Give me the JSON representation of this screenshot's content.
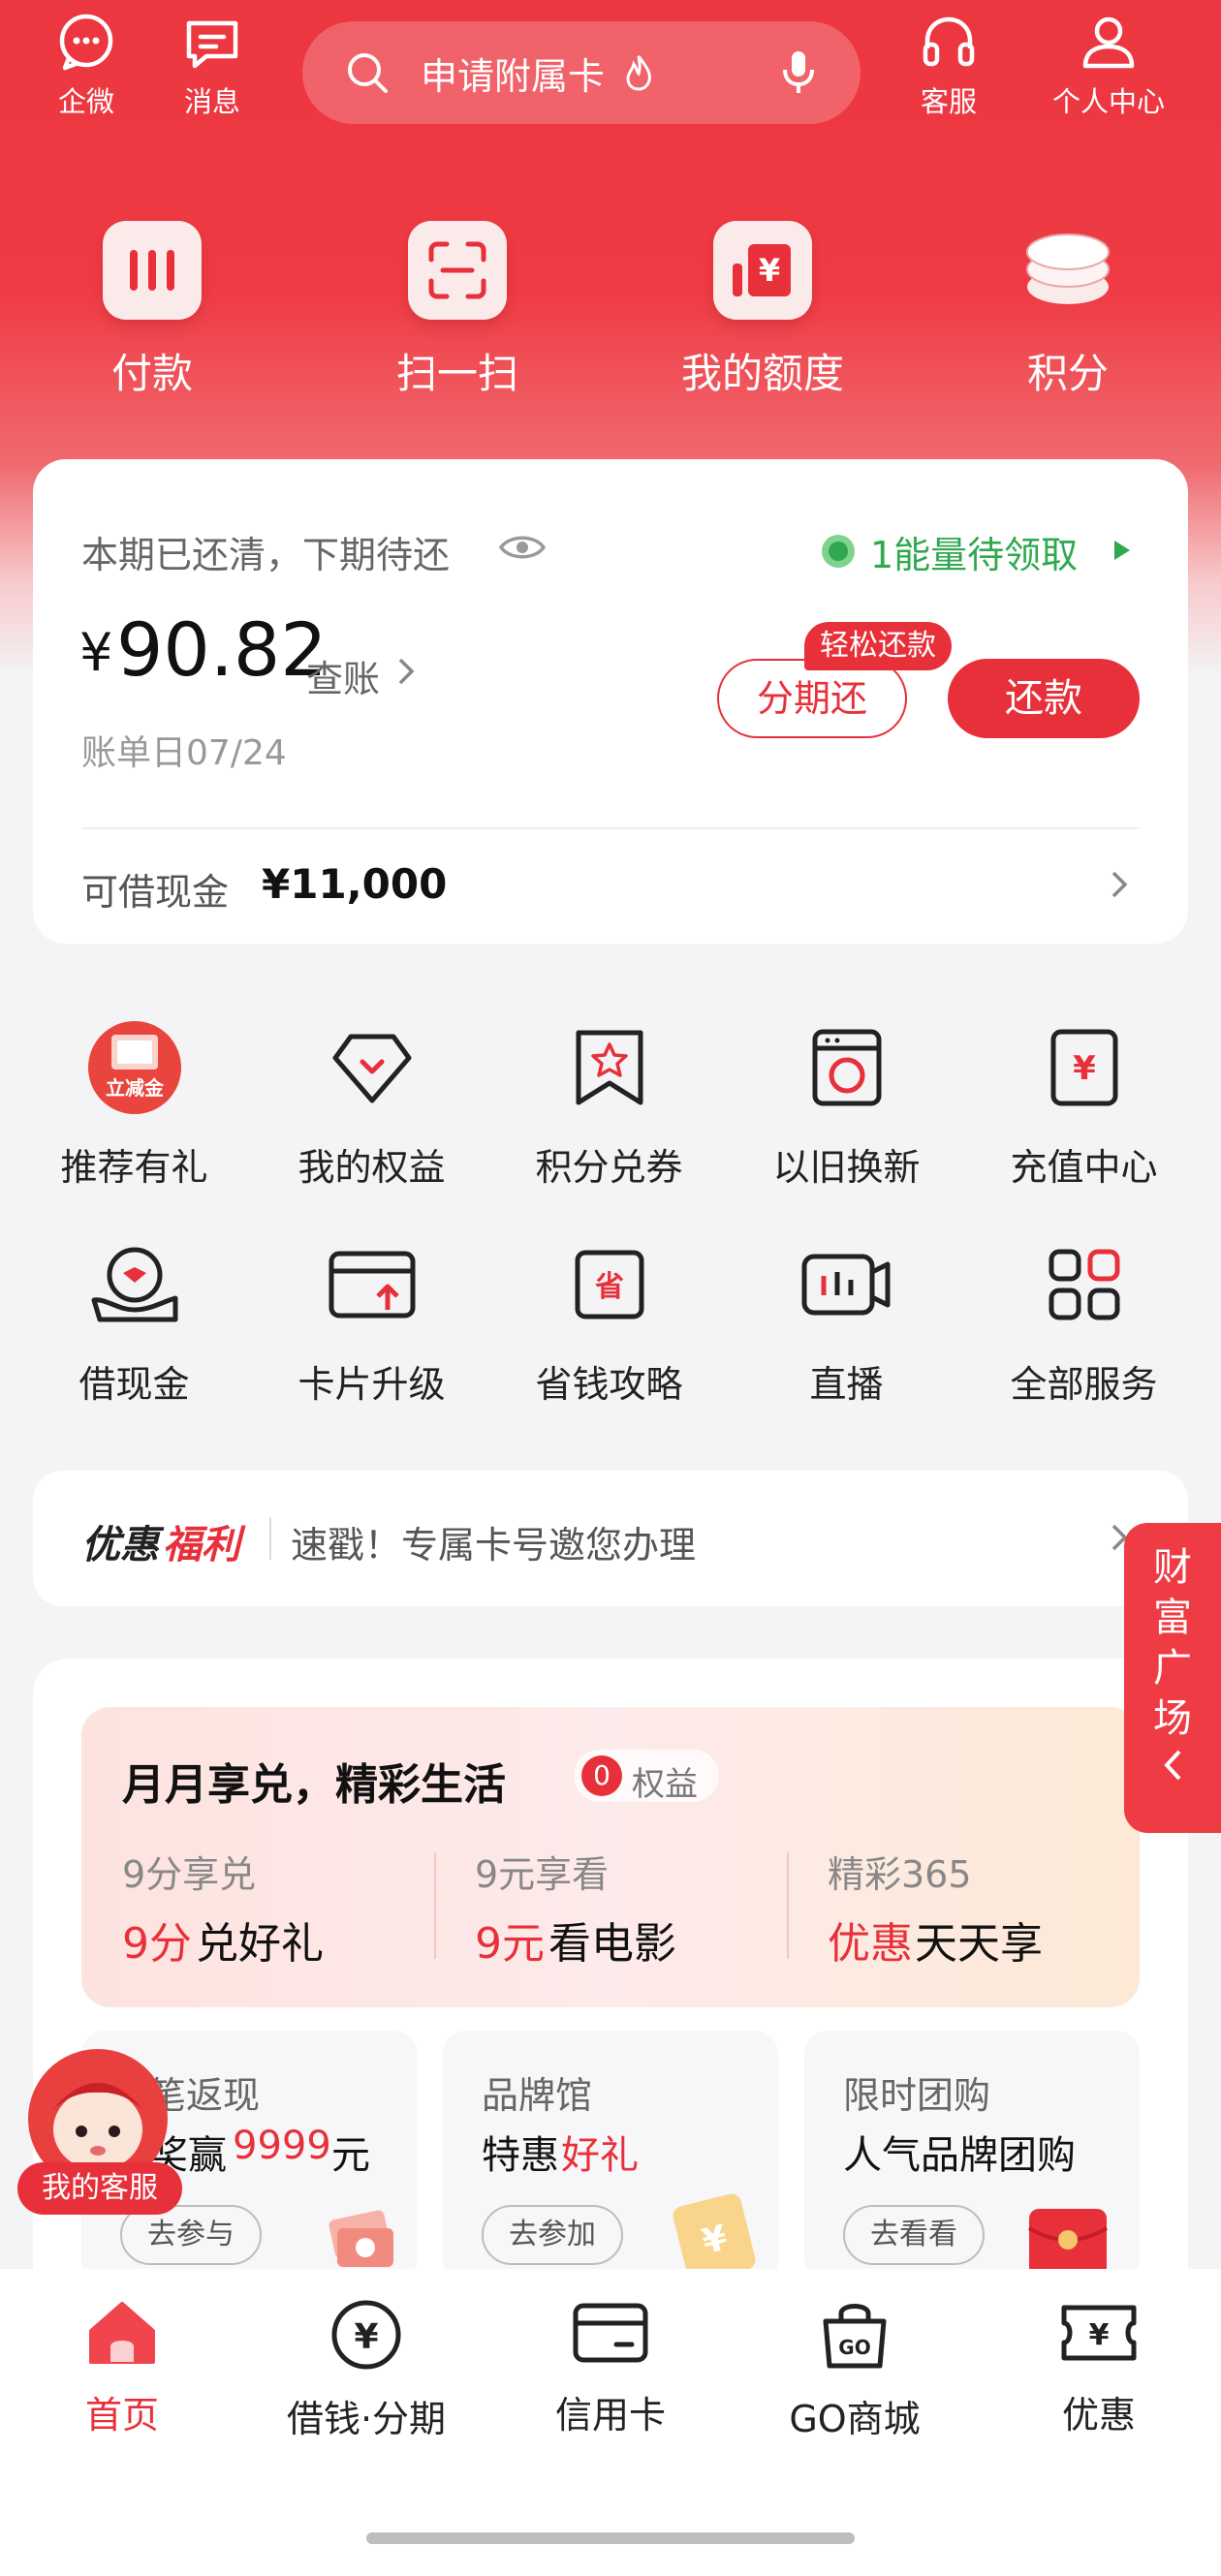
{
  "header": {
    "left_icons": [
      {
        "label": "企微",
        "icon": "chat-bubble-icon"
      },
      {
        "label": "消息",
        "icon": "message-icon"
      }
    ],
    "right_icons": [
      {
        "label": "客服",
        "icon": "headset-icon"
      },
      {
        "label": "个人中心",
        "icon": "person-icon"
      }
    ],
    "search": {
      "text": "申请附属卡",
      "icon": "search-icon",
      "mic_icon": "microphone-icon",
      "hot_icon": "flame-icon"
    },
    "quick_actions": [
      {
        "label": "付款",
        "icon": "barcode-icon"
      },
      {
        "label": "扫一扫",
        "icon": "scan-icon"
      },
      {
        "label": "我的额度",
        "icon": "yuan-limit-icon"
      },
      {
        "label": "积分",
        "icon": "coin-stack-icon"
      }
    ]
  },
  "bill": {
    "status": "本期已还清，下期待还",
    "energy": "1能量待领取",
    "currency": "¥",
    "amount": "90.82",
    "check_link": "查账",
    "bill_day": "账单日07/24",
    "installment_badge": "轻松还款",
    "installment_button": "分期还",
    "repay_button": "还款",
    "cash_label": "可借现金",
    "cash_amount": "¥11,000"
  },
  "services": [
    {
      "label": "推荐有礼",
      "icon": "gift-coupon-icon",
      "badge": "立减金"
    },
    {
      "label": "我的权益",
      "icon": "diamond-icon"
    },
    {
      "label": "积分兑券",
      "icon": "star-ticket-icon"
    },
    {
      "label": "以旧换新",
      "icon": "washer-icon"
    },
    {
      "label": "充值中心",
      "icon": "yuan-phone-icon"
    },
    {
      "label": "借现金",
      "icon": "hand-coin-icon"
    },
    {
      "label": "卡片升级",
      "icon": "card-upgrade-icon"
    },
    {
      "label": "省钱攻略",
      "icon": "save-money-icon",
      "glyph": "省"
    },
    {
      "label": "直播",
      "icon": "live-camera-icon"
    },
    {
      "label": "全部服务",
      "icon": "grid-apps-icon"
    }
  ],
  "promo": {
    "title_a": "优惠",
    "title_b": "福利",
    "text": "速戳！专属卡号邀您办理"
  },
  "side_tab": {
    "text": "财富广场",
    "chars": [
      "财",
      "富",
      "广",
      "场"
    ]
  },
  "monthly": {
    "title": "月月享兑，精彩生活",
    "count": "0",
    "count_label": "权益",
    "items": [
      {
        "sub": "9分享兑",
        "main_red": "9分",
        "main_rest": "兑好礼"
      },
      {
        "sub": "9元享看",
        "main_red": "9元",
        "main_rest": "看电影"
      },
      {
        "sub": "精彩365",
        "main_red": "优惠",
        "main_rest": "天天享"
      }
    ]
  },
  "benefits": [
    {
      "title": "笔返现",
      "line_a": "奖赢",
      "line_red": "9999",
      "line_b": "元",
      "button": "去参与"
    },
    {
      "title": "品牌馆",
      "line_a": "特惠",
      "line_red": "好礼",
      "line_b": "",
      "button": "去参加"
    },
    {
      "title": "限时团购",
      "line_a": "人气品牌团购",
      "line_red": "",
      "line_b": "",
      "button": "去看看"
    }
  ],
  "floating_service": {
    "label": "我的客服"
  },
  "bottom_nav": [
    {
      "label": "首页",
      "icon": "home-icon",
      "active": true
    },
    {
      "label": "借钱·分期",
      "icon": "yuan-circle-icon",
      "active": false
    },
    {
      "label": "信用卡",
      "icon": "credit-card-icon",
      "active": false
    },
    {
      "label": "GO商城",
      "icon": "shopping-bag-icon",
      "active": false
    },
    {
      "label": "优惠",
      "icon": "yuan-ticket-icon",
      "active": false
    }
  ],
  "colors": {
    "brand_red": "#e8303a",
    "header_red": "#ec3640",
    "energy_green": "#2fa84f"
  }
}
